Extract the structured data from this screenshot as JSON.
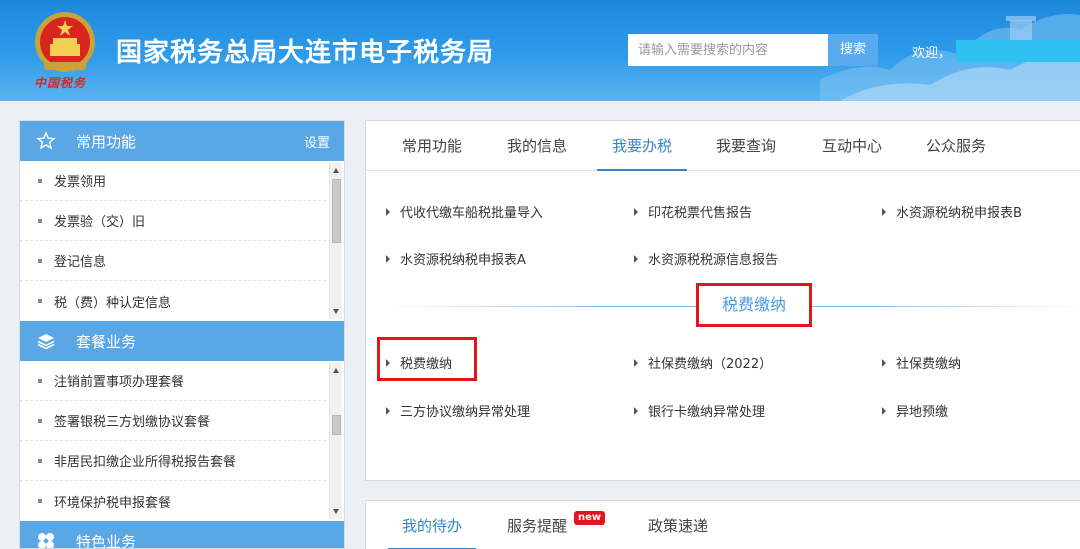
{
  "header": {
    "site_title": "国家税务总局大连市电子税务局",
    "brand_script": "中国税务",
    "search_placeholder": "请输入需要搜索的内容",
    "search_button": "搜索",
    "welcome": "欢迎，"
  },
  "sidebar": {
    "sections": [
      {
        "title": "常用功能",
        "icon": "star-icon",
        "action": "设置",
        "items": [
          "发票领用",
          "发票验（交）旧",
          "登记信息",
          "税（费）种认定信息"
        ]
      },
      {
        "title": "套餐业务",
        "icon": "layers-icon",
        "items": [
          "注销前置事项办理套餐",
          "签署银税三方划缴协议套餐",
          "非居民扣缴企业所得税报告套餐",
          "环境保护税申报套餐"
        ]
      },
      {
        "title": "特色业务",
        "icon": "clover-icon"
      }
    ]
  },
  "main": {
    "tabs": [
      "常用功能",
      "我的信息",
      "我要办税",
      "我要查询",
      "互动中心",
      "公众服务"
    ],
    "active_tab": "我要办税",
    "group1": [
      "代收代缴车船税批量导入",
      "印花税票代售报告",
      "水资源税纳税申报表B",
      "水资源税纳税申报表A",
      "水资源税税源信息报告"
    ],
    "section_title": "税费缴纳",
    "group2": [
      "税费缴纳",
      "社保费缴纳（2022）",
      "社保费缴纳",
      "三方协议缴纳异常处理",
      "银行卡缴纳异常处理",
      "异地预缴"
    ]
  },
  "bottom": {
    "tabs": [
      "我的待办",
      "服务提醒",
      "政策速递"
    ],
    "badge": "new"
  },
  "colors": {
    "accent": "#2f86d3",
    "header_blue": "#1e88db",
    "sidebar_head": "#5aa7e6",
    "highlight_red": "#e0161b"
  }
}
